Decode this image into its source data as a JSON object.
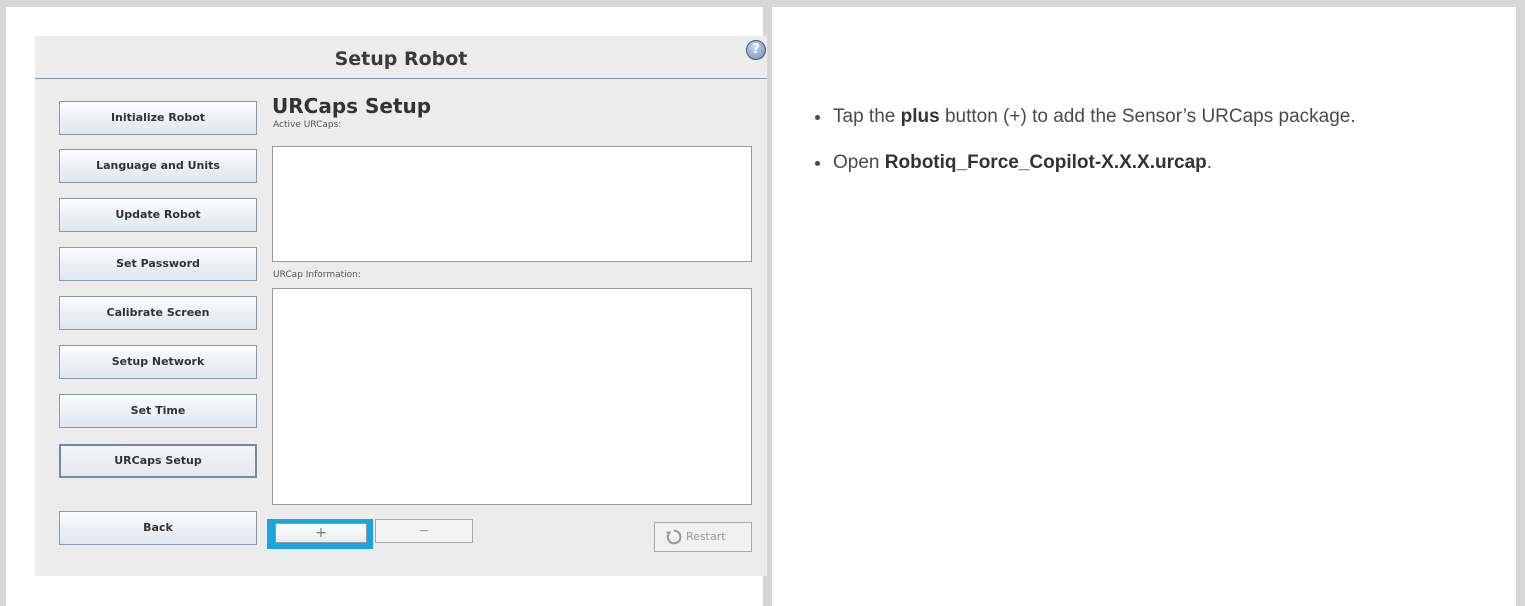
{
  "robot": {
    "title": "Setup Robot",
    "help_icon": "question-circle-icon",
    "section_title": "URCaps Setup",
    "active_label": "Active URCaps:",
    "info_label": "URCap Information:",
    "add_symbol": "+",
    "remove_symbol": "−",
    "restart_label": "Restart",
    "accent_color": "#17a7e0",
    "menu": [
      {
        "label": "Initialize Robot"
      },
      {
        "label": "Language and Units"
      },
      {
        "label": "Update Robot"
      },
      {
        "label": "Set Password"
      },
      {
        "label": "Calibrate Screen"
      },
      {
        "label": "Setup Network"
      },
      {
        "label": "Set Time"
      },
      {
        "label": "URCaps Setup"
      }
    ],
    "back_label": "Back"
  },
  "instructions": {
    "step1": {
      "prefix": "Tap the ",
      "bold": "plus",
      "suffix": " button (+) to add the Sensor’s URCaps package."
    },
    "step2": {
      "prefix": "Open ",
      "bold": "Robotiq_Force_Copilot-X.X.X.urcap",
      "suffix": "."
    }
  }
}
